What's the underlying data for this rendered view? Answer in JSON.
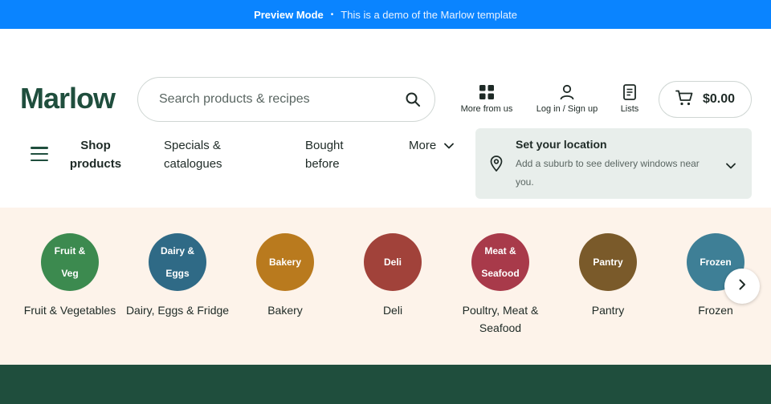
{
  "preview": {
    "mode": "Preview Mode",
    "separator": "•",
    "message": "This is a demo of the Marlow template"
  },
  "brand": {
    "logo": "Marlow",
    "color": "#1f4e3d"
  },
  "search": {
    "placeholder": "Search products & recipes",
    "icon": "search-icon"
  },
  "header": {
    "more_from_us": "More from us",
    "login": "Log in / Sign up",
    "lists": "Lists",
    "cart_total": "$0.00"
  },
  "nav": {
    "shop_products": "Shop products",
    "specials": "Specials & catalogues",
    "bought_before": "Bought before",
    "more": "More"
  },
  "location": {
    "title": "Set your location",
    "description": "Add a suburb to see delivery windows near you."
  },
  "categories": [
    {
      "circle": "Fruit & Veg",
      "label": "Fruit & Vegetables",
      "color": "#3c8a4f"
    },
    {
      "circle": "Dairy & Eggs",
      "label": "Dairy, Eggs & Fridge",
      "color": "#2f6a86"
    },
    {
      "circle": "Bakery",
      "label": "Bakery",
      "color": "#b97a1e"
    },
    {
      "circle": "Deli",
      "label": "Deli",
      "color": "#a1423a"
    },
    {
      "circle": "Meat & Seafood",
      "label": "Poultry, Meat & Seafood",
      "color": "#a83a4a"
    },
    {
      "circle": "Pantry",
      "label": "Pantry",
      "color": "#7a5a2a"
    },
    {
      "circle": "Frozen",
      "label": "Frozen",
      "color": "#3e7f96"
    }
  ],
  "colors": {
    "preview_bar": "#0a84ff",
    "category_bg": "#fdf3ea",
    "footer": "#1f4e3d",
    "location_bg": "#e8eeeb"
  }
}
